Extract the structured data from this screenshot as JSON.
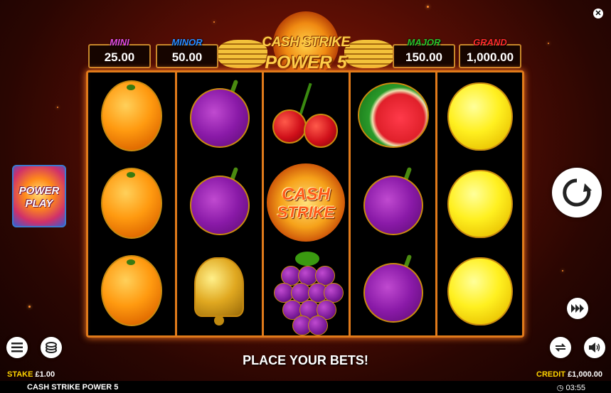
{
  "jackpots": [
    {
      "label": "MINI",
      "value": "25.00",
      "color": "#e04ae0"
    },
    {
      "label": "MINOR",
      "value": "50.00",
      "color": "#2a8aff"
    },
    {
      "label": "MAJOR",
      "value": "150.00",
      "color": "#2ac02a"
    },
    {
      "label": "GRAND",
      "value": "1,000.00",
      "color": "#ff2a2a"
    }
  ],
  "logo": {
    "line1": "CASH STRIKE",
    "line2": "POWER 5"
  },
  "reels": [
    [
      "orange-icon",
      "orange-icon",
      "orange-icon"
    ],
    [
      "plum-icon",
      "plum-icon",
      "bell-icon"
    ],
    [
      "cherry-icon",
      "cash-strike-icon",
      "grapes-icon"
    ],
    [
      "watermelon-icon",
      "plum-icon",
      "plum-icon"
    ],
    [
      "lemon-icon",
      "lemon-icon",
      "lemon-icon"
    ]
  ],
  "cash_strike": {
    "line1": "CASH",
    "line2": "STRIKE"
  },
  "power_play": {
    "line1": "POWER",
    "line2": "PLAY"
  },
  "message": "PLACE YOUR BETS!",
  "footer": {
    "stake_label": "STAKE",
    "stake_value": "£1.00",
    "credit_label": "CREDIT",
    "credit_value": "£1,000.00",
    "game_name": "CASH STRIKE POWER 5",
    "time": "03:55"
  },
  "icons": {
    "spin": "spin-refresh-icon",
    "menu": "menu-icon",
    "coins": "coins-icon",
    "autoplay": "autoplay-icon",
    "turbo": "turbo-icon",
    "sound": "sound-icon",
    "close": "close-icon",
    "clock": "clock-icon"
  },
  "accent": "#e07a1a"
}
